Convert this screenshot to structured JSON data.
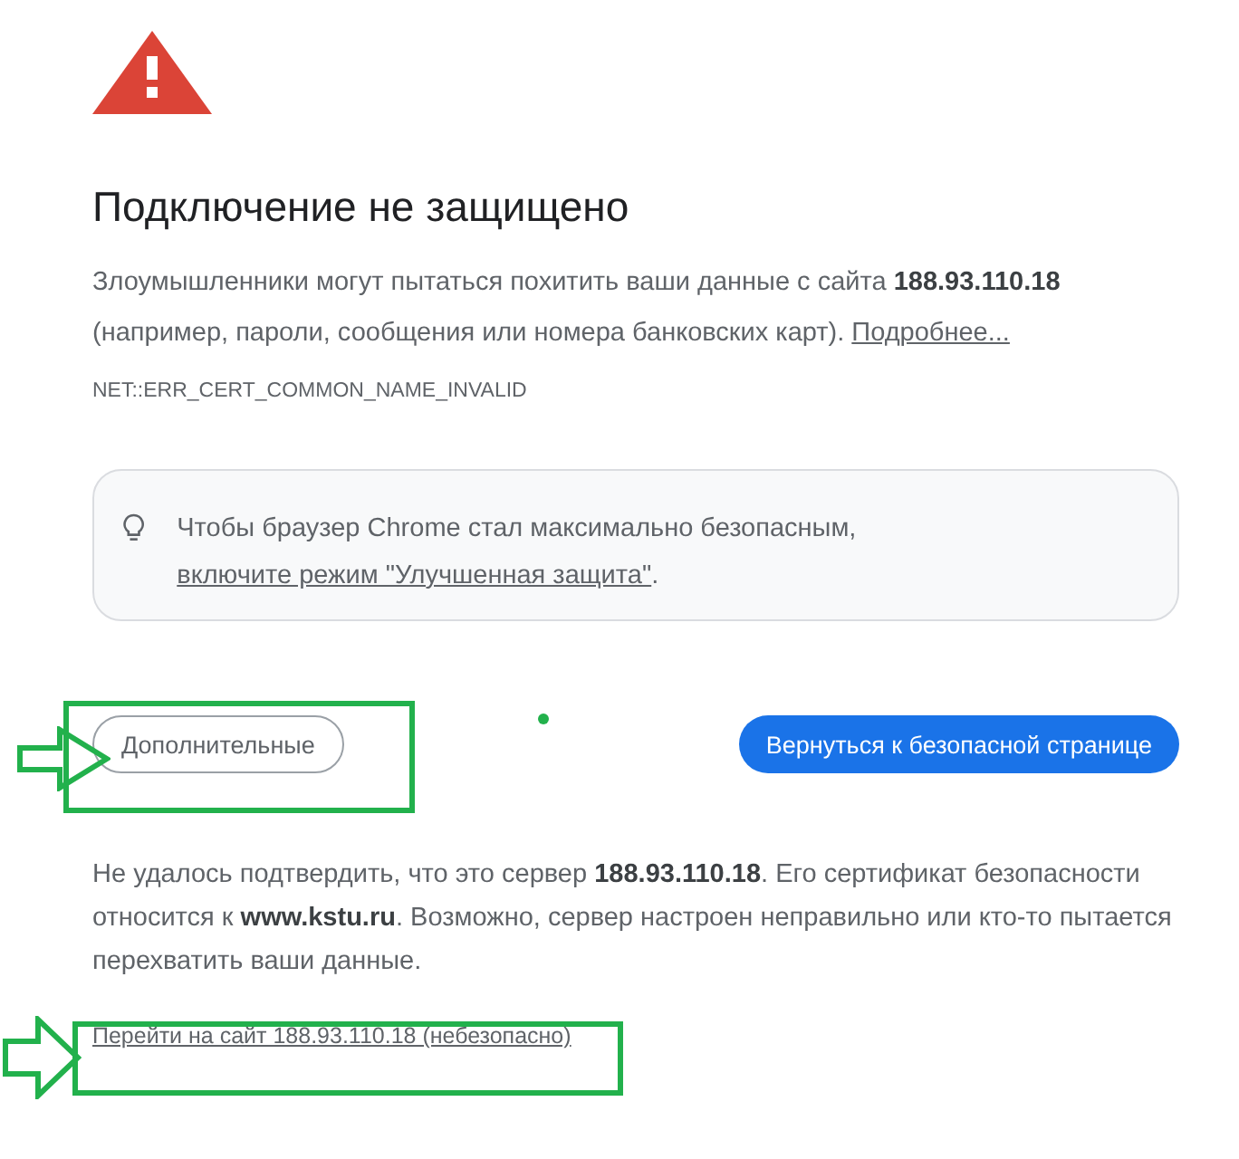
{
  "title": "Подключение не защищено",
  "warning": {
    "text": "Злоумышленники могут пытаться похитить ваши данные с сайта **188.93.110.18** (например, пароли, сообщения или номера банковских карт). ",
    "link": "Подробнее..."
  },
  "error_code": "NET::ERR_CERT_COMMON_NAME_INVALID",
  "tip": {
    "text": "Чтобы браузер Chrome стал максимально безопасным, ",
    "link": "включите режим \"Улучшенная защита\"",
    "after": "."
  },
  "buttons": [
    {
      "label": "Дополнительные",
      "kind": "secondary"
    },
    {
      "label": "Вернуться к безопасной странице",
      "kind": "primary"
    }
  ],
  "details": "Не удалось подтвердить, что это сервер **188.93.110.18**. Его сертификат безопасности относится к **www.kstu.ru**. Возможно, сервер настроен неправильно или кто-то пытается перехватить ваши данные.",
  "proceed_link": "Перейти на сайт 188.93.110.18 (небезопасно)"
}
